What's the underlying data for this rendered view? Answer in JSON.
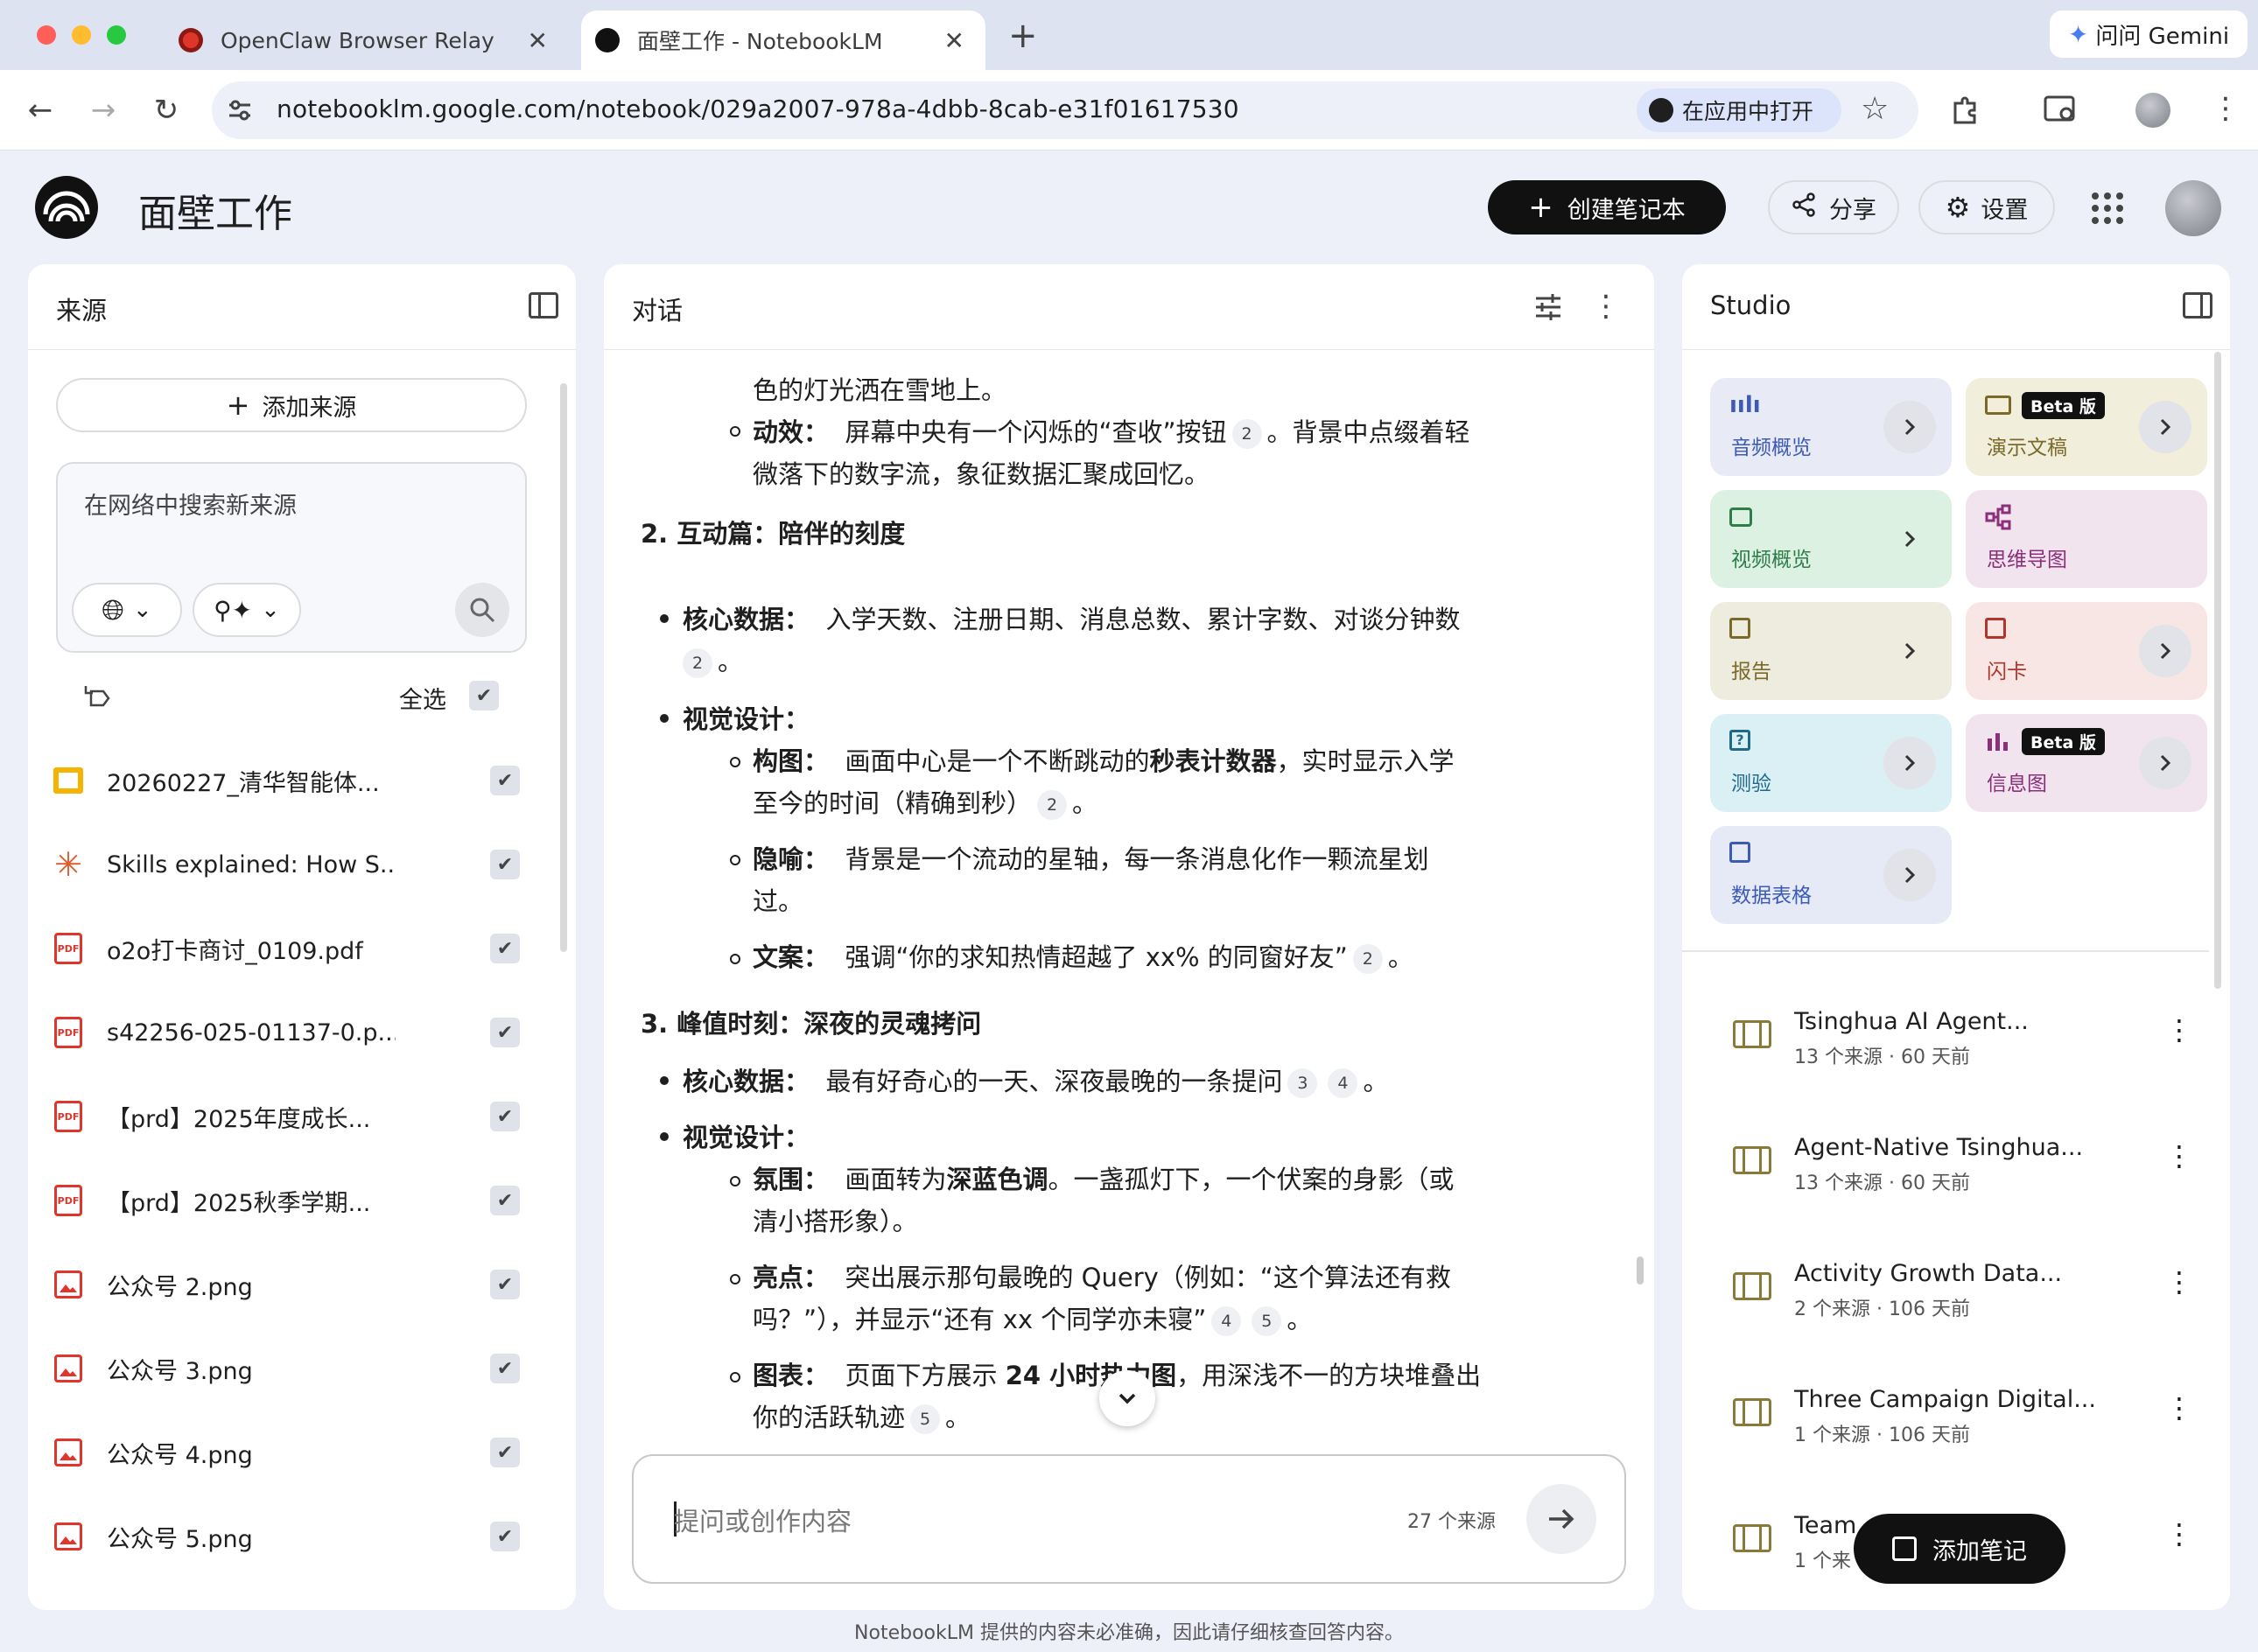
{
  "browser": {
    "tabs": [
      {
        "title": "OpenClaw Browser Relay"
      },
      {
        "title": "面壁工作 - NotebookLM"
      }
    ],
    "new_tab": "+",
    "gemini_label": "问问 Gemini",
    "url": "notebooklm.google.com/notebook/029a2007-978a-4dbb-8cab-e31f01617530",
    "open_in_app": "在应用中打开"
  },
  "header": {
    "title": "面壁工作",
    "create_label": "创建笔记本",
    "share_label": "分享",
    "settings_label": "设置"
  },
  "sources": {
    "title": "来源",
    "add_label": "添加来源",
    "search_placeholder": "在网络中搜索新来源",
    "select_all": "全选",
    "items": [
      {
        "name": "20260227_清华智能体...",
        "type": "slides"
      },
      {
        "name": "Skills explained: How S...",
        "type": "web"
      },
      {
        "name": "o2o打卡商讨_0109.pdf",
        "type": "pdf"
      },
      {
        "name": "s42256-025-01137-0.p...",
        "type": "pdf"
      },
      {
        "name": "【prd】2025年度成长...",
        "type": "pdf"
      },
      {
        "name": "【prd】2025秋季学期...",
        "type": "pdf"
      },
      {
        "name": "公众号 2.png",
        "type": "image"
      },
      {
        "name": "公众号 3.png",
        "type": "image"
      },
      {
        "name": "公众号 4.png",
        "type": "image"
      },
      {
        "name": "公众号 5.png",
        "type": "image"
      }
    ],
    "pdf_badge": "PDF"
  },
  "chat": {
    "title": "对话",
    "lines": {
      "l1": "色的灯光洒在雪地上。",
      "l2a_label": "动效：",
      "l2a": "屏幕中央有一个闪烁的“查收”按钮",
      "l2a_tail": "。背景中点缀着轻",
      "l2b": "微落下的数字流，象征数据汇聚成回忆。",
      "h2": "2. 互动篇：陪伴的刻度",
      "core1_label": "核心数据：",
      "core1": "入学天数、注册日期、消息总数、累计字数、对谈分钟数",
      "core1_tail": "。",
      "visual1_label": "视觉设计：",
      "comp_label": "构图：",
      "comp_a": "画面中心是一个不断跳动的",
      "comp_bold": "秒表计数器",
      "comp_b": "，实时显示入学",
      "comp_c": "至今的时间（精确到秒）",
      "comp_tail": "。",
      "meta_label": "隐喻：",
      "meta_a": "背景是一个流动的星轴，每一条消息化作一颗流星划",
      "meta_b": "过。",
      "copy_label": "文案：",
      "copy_a": "强调“你的求知热情超越了 xx% 的同窗好友”",
      "copy_tail": "。",
      "h3": "3. 峰值时刻：深夜的灵魂拷问",
      "core2_label": "核心数据：",
      "core2": "最有好奇心的一天、深夜最晚的一条提问",
      "core2_tail": "。",
      "visual2_label": "视觉设计：",
      "atm_label": "氛围：",
      "atm_a": "画面转为",
      "atm_bold": "深蓝色调",
      "atm_b": "。一盏孤灯下，一个伏案的身影（或",
      "atm_c": "清小搭形象）。",
      "hl_label": "亮点：",
      "hl_a": "突出展示那句最晚的 Query（例如：“这个算法还有救",
      "hl_b": "吗？”），并显示“还有 xx 个同学亦未寝”",
      "hl_tail": "。",
      "chart_label": "图表：",
      "chart_a": "页面下方展示",
      "chart_bold": "24 小时热力图",
      "chart_b": "，用深浅不一的方块堆叠出",
      "chart_c": "你的活跃轨迹",
      "chart_tail": "。"
    },
    "cites": {
      "c2": "2",
      "c3": "3",
      "c4": "4",
      "c5": "5"
    },
    "input_placeholder": "提问或创作内容",
    "source_count": "27 个来源"
  },
  "studio": {
    "title": "Studio",
    "beta": "Beta 版",
    "cards": {
      "audio": "音频概览",
      "slides": "演示文稿",
      "video": "视频概览",
      "mindmap": "思维导图",
      "report": "报告",
      "flashcards": "闪卡",
      "quiz": "测验",
      "infographic": "信息图",
      "table": "数据表格"
    },
    "colors": {
      "audio": "#e8eaf6",
      "slides": "#f1eedc",
      "video": "#dcf1e1",
      "mindmap": "#f2e4ef",
      "report": "#eeecdf",
      "flashcards": "#f7e6e3",
      "quiz": "#daf0f5",
      "infographic": "#f2e4ef",
      "table": "#e6e9f6"
    },
    "notes": [
      {
        "title": "Tsinghua AI Agent...",
        "meta": "13 个来源 · 60 天前"
      },
      {
        "title": "Agent-Native Tsinghua...",
        "meta": "13 个来源 · 60 天前"
      },
      {
        "title": "Activity Growth Data...",
        "meta": "2 个来源 · 106 天前"
      },
      {
        "title": "Three Campaign Digital...",
        "meta": "1 个来源 · 106 天前"
      },
      {
        "title": "Team",
        "meta": "1 个来"
      }
    ],
    "add_note_label": "添加笔记"
  },
  "footer": {
    "disclaimer": "NotebookLM 提供的内容未必准确，因此请仔细核查回答内容。"
  }
}
